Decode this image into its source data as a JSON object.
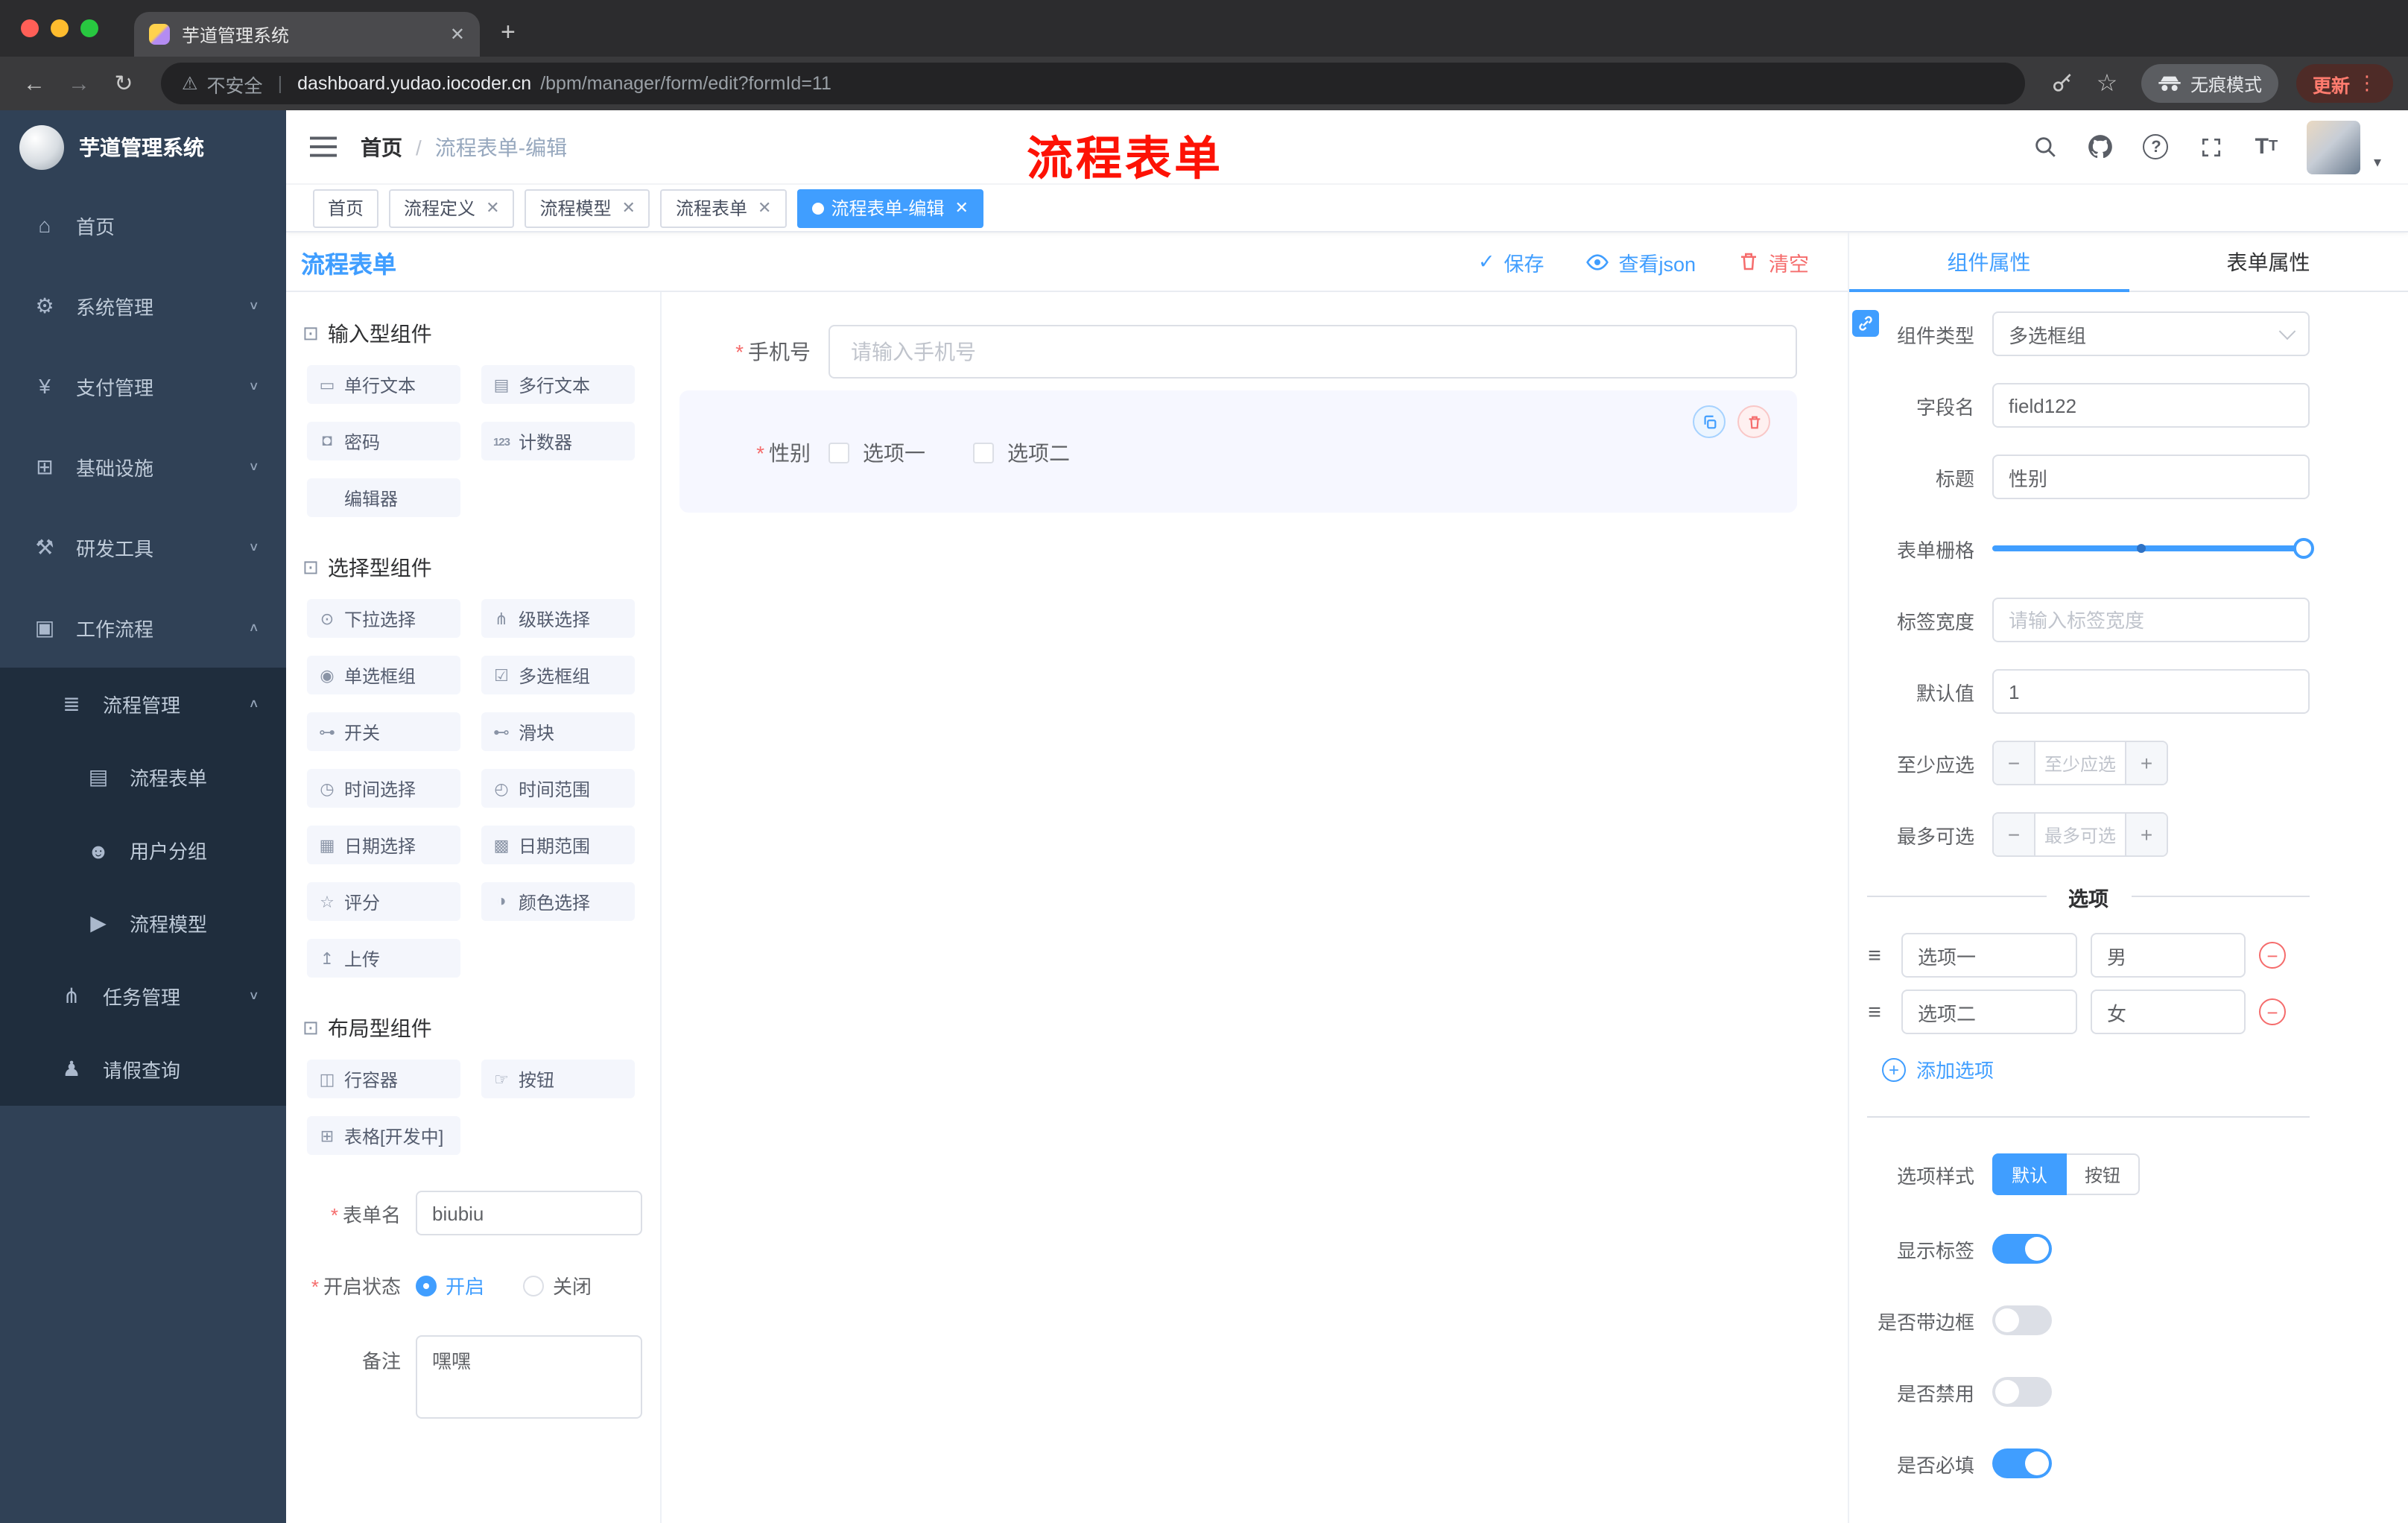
{
  "glyphs": {
    "close": "✕",
    "plus": "+",
    "minus": "−",
    "dots": "⋮",
    "star": "☆",
    "back": "←",
    "forward": "→",
    "reload": "↻",
    "warn": "⚠",
    "sep": "|",
    "check": "✓",
    "caret_down": "▾",
    "question": "?",
    "t_big": "T",
    "t_small": "T",
    "handle": "≡",
    "section": "⊡",
    "breadcrumb_sep": "/"
  },
  "browser": {
    "tab_title": "芋道管理系统",
    "security_label": "不安全",
    "url_host": "dashboard.yudao.iocoder.cn",
    "url_path": "/bpm/manager/form/edit?formId=11",
    "incognito_label": "无痕模式",
    "update_label": "更新"
  },
  "annotation": {
    "text": "流程表单",
    "color": "#fd1205"
  },
  "sidebar": {
    "logo_title": "芋道管理系统",
    "items": [
      {
        "label": "首页",
        "icon": "home-icon",
        "glyph": "⌂",
        "chev": ""
      },
      {
        "label": "系统管理",
        "icon": "gear-icon",
        "glyph": "⚙",
        "chev": "∨"
      },
      {
        "label": "支付管理",
        "icon": "yen-icon",
        "glyph": "¥",
        "chev": "∨"
      },
      {
        "label": "基础设施",
        "icon": "infra-icon",
        "glyph": "⊞",
        "chev": "∨"
      },
      {
        "label": "研发工具",
        "icon": "tools-icon",
        "glyph": "⚒",
        "chev": "∨"
      },
      {
        "label": "工作流程",
        "icon": "workflow-icon",
        "glyph": "▣",
        "chev": "∧"
      },
      {
        "label": "流程管理",
        "icon": "list-icon",
        "glyph": "≣",
        "chev": "∧"
      },
      {
        "label": "流程表单",
        "icon": "form-icon",
        "glyph": "▤",
        "chev": ""
      },
      {
        "label": "用户分组",
        "icon": "users-icon",
        "glyph": "☻",
        "chev": ""
      },
      {
        "label": "流程模型",
        "icon": "model-icon",
        "glyph": "▶",
        "chev": ""
      },
      {
        "label": "任务管理",
        "icon": "task-icon",
        "glyph": "⋔",
        "chev": "∨"
      },
      {
        "label": "请假查询",
        "icon": "person-icon",
        "glyph": "♟",
        "chev": ""
      }
    ]
  },
  "header": {
    "breadcrumb_home": "首页",
    "breadcrumb_current": "流程表单-编辑"
  },
  "tags": {
    "items": [
      {
        "label": "首页"
      },
      {
        "label": "流程定义"
      },
      {
        "label": "流程模型"
      },
      {
        "label": "流程表单"
      },
      {
        "label": "流程表单-编辑"
      }
    ]
  },
  "page": {
    "title": "流程表单",
    "save_label": "保存",
    "view_json_label": "查看json",
    "clear_label": "清空"
  },
  "palette": {
    "sections": [
      {
        "title": "输入型组件",
        "items": [
          {
            "label": "单行文本",
            "glyph": "▭"
          },
          {
            "label": "多行文本",
            "glyph": "▤"
          },
          {
            "label": "密码",
            "glyph": "◘"
          },
          {
            "label": "计数器",
            "glyph": "123"
          },
          {
            "label": "编辑器",
            "glyph": ""
          }
        ]
      },
      {
        "title": "选择型组件",
        "items": [
          {
            "label": "下拉选择",
            "glyph": "⊙"
          },
          {
            "label": "级联选择",
            "glyph": "⋔"
          },
          {
            "label": "单选框组",
            "glyph": "◉"
          },
          {
            "label": "多选框组",
            "glyph": "☑"
          },
          {
            "label": "开关",
            "glyph": "⊶"
          },
          {
            "label": "滑块",
            "glyph": "⊷"
          },
          {
            "label": "时间选择",
            "glyph": "◷"
          },
          {
            "label": "时间范围",
            "glyph": "◴"
          },
          {
            "label": "日期选择",
            "glyph": "▦"
          },
          {
            "label": "日期范围",
            "glyph": "▩"
          },
          {
            "label": "评分",
            "glyph": "☆"
          },
          {
            "label": "颜色选择",
            "glyph": "◑"
          },
          {
            "label": "上传",
            "glyph": "↥"
          }
        ]
      },
      {
        "title": "布局型组件",
        "items": [
          {
            "label": "行容器",
            "glyph": "◫"
          },
          {
            "label": "按钮",
            "glyph": "☞"
          },
          {
            "label": "表格[开发中]",
            "glyph": "⊞"
          }
        ]
      }
    ],
    "form": {
      "name_label": "表单名",
      "name_value": "biubiu",
      "status_label": "开启状态",
      "on_label": "开启",
      "off_label": "关闭",
      "remark_label": "备注",
      "remark_value": "嘿嘿"
    }
  },
  "canvas": {
    "phone_label": "手机号",
    "phone_placeholder": "请输入手机号",
    "gender_label": "性别",
    "option1": "选项一",
    "option2": "选项二"
  },
  "props": {
    "tab_component": "组件属性",
    "tab_form": "表单属性",
    "type_label": "组件类型",
    "type_value": "多选框组",
    "field_label": "字段名",
    "field_value": "field122",
    "title_label": "标题",
    "title_value": "性别",
    "grid_label": "表单栅格",
    "label_width_label": "标签宽度",
    "label_width_placeholder": "请输入标签宽度",
    "default_label": "默认值",
    "default_value": "1",
    "min_label": "至少应选",
    "min_placeholder": "至少应选",
    "max_label": "最多可选",
    "max_placeholder": "最多可选",
    "options_title": "选项",
    "options": [
      {
        "label": "选项一",
        "value": "男"
      },
      {
        "label": "选项二",
        "value": "女"
      }
    ],
    "add_option_label": "添加选项",
    "style_label": "选项样式",
    "style_default": "默认",
    "style_button": "按钮",
    "show_label_label": "显示标签",
    "border_label": "是否带边框",
    "disabled_label": "是否禁用",
    "required_label": "是否必填"
  },
  "colors": {
    "accent": "#409eff",
    "danger": "#f56c6c",
    "sidebar_bg": "#304156",
    "submenu_bg": "#1f2d3d"
  }
}
